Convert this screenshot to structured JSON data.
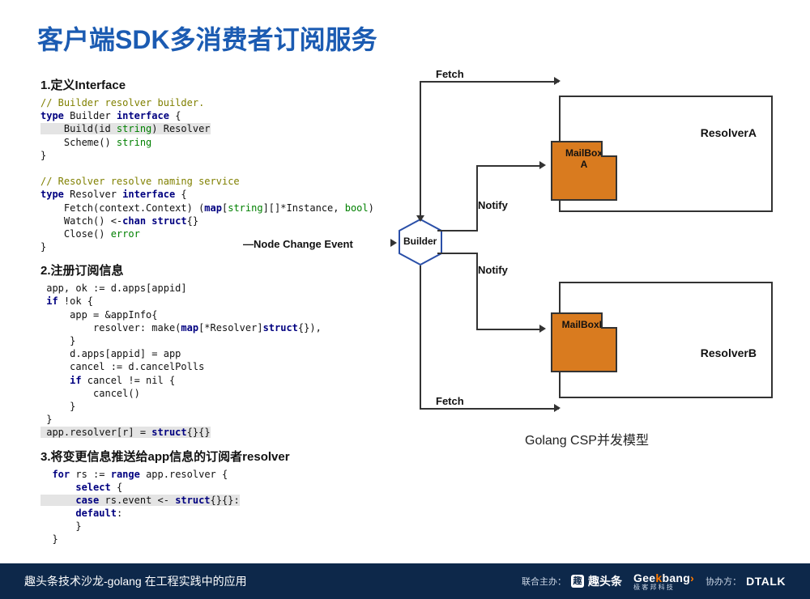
{
  "title": "客户端SDK多消费者订阅服务",
  "sections": {
    "s1": "1.定义Interface",
    "s2": "2.注册订阅信息",
    "s3": "3.将变更信息推送给app信息的订阅者resolver"
  },
  "code1": {
    "c1": "// Builder resolver builder.",
    "l2a": "type",
    "l2b": " Builder ",
    "l2c": "interface",
    "l2d": " {",
    "l3a": "    Build(id ",
    "l3b": "string",
    "l3c": ") Resolver",
    "l4a": "    Scheme() ",
    "l4b": "string",
    "l5": "}",
    "c2": "// Resolver resolve naming service",
    "l7a": "type",
    "l7b": " Resolver ",
    "l7c": "interface",
    "l7d": " {",
    "l8a": "    Fetch(context.Context) (",
    "l8b": "map",
    "l8c": "[",
    "l8d": "string",
    "l8e": "][]*Instance, ",
    "l8f": "bool",
    "l8g": ")",
    "l9a": "    Watch() <-",
    "l9b": "chan",
    "l9c": " ",
    "l9d": "struct",
    "l9e": "{}",
    "l10a": "    Close() ",
    "l10b": "error",
    "l11": "}"
  },
  "code2": {
    "l1": " app, ok := d.apps[appid]",
    "l2a": " ",
    "l2b": "if",
    "l2c": " !ok {",
    "l3": "     app = &appInfo{",
    "l4a": "         resolver: make(",
    "l4b": "map",
    "l4c": "[*Resolver]",
    "l4d": "struct",
    "l4e": "{}),",
    "l5": "     }",
    "l6": "     d.apps[appid] = app",
    "l7": "     cancel := d.cancelPolls",
    "l8a": "     ",
    "l8b": "if",
    "l8c": " cancel != nil {",
    "l9": "         cancel()",
    "l10": "     }",
    "l11": " }",
    "l12a": " app.resolver[r] = ",
    "l12b": "struct",
    "l12c": "{}{}"
  },
  "code3": {
    "l1a": "  ",
    "l1b": "for",
    "l1c": " rs := ",
    "l1d": "range",
    "l1e": " app.resolver {",
    "l2a": "      ",
    "l2b": "select",
    "l2c": " {",
    "l3a": "      ",
    "l3b": "case",
    "l3c": " rs.event <- ",
    "l3d": "struct",
    "l3e": "{}{}:",
    "l4a": "      ",
    "l4b": "default",
    "l4c": ":",
    "l5": "      }",
    "l6": "  }"
  },
  "diagram": {
    "nce": "—Node Change Event",
    "builder": "Builder",
    "fetch": "Fetch",
    "notify": "Notify",
    "resolverA": "ResolverA",
    "resolverB": "ResolverB",
    "mailboxA_l1": "MailBox",
    "mailboxA_l2": "A",
    "mailboxB": "MailBoxB",
    "caption": "Golang  CSP并发模型"
  },
  "footer": {
    "text": "趣头条技术沙龙-golang 在工程实践中的应用",
    "host_label": "联合主办：",
    "qtt": "趣头条",
    "geek1": "Gee",
    "geek2": "k",
    "geek3": "bang",
    "geek4": "›",
    "geek_sub": "极 客 邦 科 技",
    "coop_label": "协办方：",
    "dtalk": "DTALK"
  }
}
